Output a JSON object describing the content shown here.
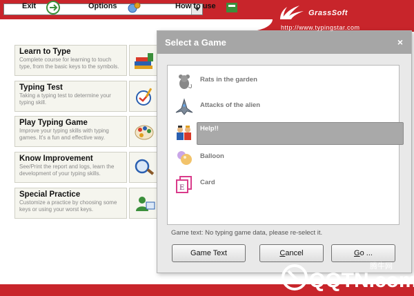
{
  "header": {
    "dropdown_value": "",
    "brand": "GrassSoft",
    "url": "http://www.typingstar.com"
  },
  "menu": [
    {
      "title": "Learn to Type",
      "desc": "Complete course for learning to touch type, from the basic keys to the symbols.",
      "icon": "books-icon"
    },
    {
      "title": "Typing Test",
      "desc": "Taking a typing test to determine your typing skill.",
      "icon": "test-icon"
    },
    {
      "title": "Play Typing Game",
      "desc": "Improve your typing skills with typing games. It's a fun and effective way.",
      "icon": "palette-icon"
    },
    {
      "title": "Know Improvement",
      "desc": "See/Print the report and logs, learn the development of your typing skills.",
      "icon": "magnifier-icon"
    },
    {
      "title": "Special Practice",
      "desc": "Customize a practice by choosing some keys or using your worst keys.",
      "icon": "user-icon"
    }
  ],
  "bottom": {
    "exit": "Exit",
    "options": "Options",
    "how_to_use": "How to use"
  },
  "dialog": {
    "title": "Select a Game",
    "close": "×",
    "games": [
      {
        "label": "Rats in the garden",
        "icon": "rat-icon"
      },
      {
        "label": "Attacks of the alien",
        "icon": "spaceship-icon"
      },
      {
        "label": "Help!!",
        "icon": "people-icon",
        "selected": true
      },
      {
        "label": "Balloon",
        "icon": "balloon-icon"
      },
      {
        "label": "Card",
        "icon": "card-icon"
      }
    ],
    "game_text": "Game text: No typing game data, please re-select it.",
    "buttons": {
      "game_text": "Game Text",
      "cancel_prefix": "C",
      "cancel_rest": "ancel",
      "go_prefix": "G",
      "go_rest": "o ..."
    }
  },
  "watermark": {
    "text": "QQTN.com",
    "cn": "腾牛网"
  },
  "colors": {
    "brand_red": "#c8252b",
    "dialog_title_bg": "#a6a6a6",
    "selected_row": "#a9a9a9"
  }
}
